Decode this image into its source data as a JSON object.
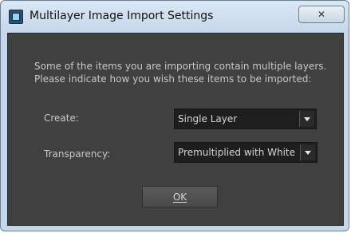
{
  "window": {
    "title": "Multilayer Image Import Settings",
    "close_glyph": "✕",
    "icon": "app-window-icon"
  },
  "message": {
    "line1": "Some of the items you are importing contain multiple layers.",
    "line2": "Please indicate how you wish these items to be imported:"
  },
  "fields": {
    "create": {
      "label": "Create:",
      "value": "Single Layer"
    },
    "transparency": {
      "label": "Transparency:",
      "value": "Premultiplied with White"
    }
  },
  "ok_button": {
    "label": "OK"
  },
  "colors": {
    "client_bg": "#404040",
    "text": "#c8c8c8",
    "select_bg": "#1e1e1e",
    "titlebar": "#c7d8eb"
  }
}
